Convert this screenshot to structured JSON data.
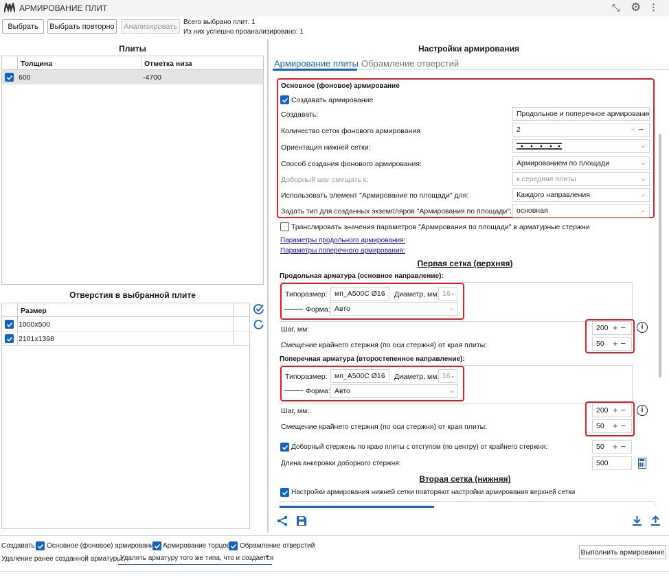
{
  "app": {
    "title": "АРМИРОВАНИЕ ПЛИТ"
  },
  "toolbar": {
    "select_label": "Выбрать",
    "reselect_label": "Выбрать повторно",
    "analyze_label": "Анализировать",
    "total_selected": "Всего выбрано плит: 1",
    "analyzed": "Из них успешно проанализировано: 1"
  },
  "slabs": {
    "title": "Плиты",
    "columns": [
      "Толщина",
      "Отметка низа"
    ],
    "rows": [
      {
        "thickness": "600",
        "bottom": "-4700"
      }
    ]
  },
  "openings": {
    "title": "Отверстия в выбранной плите",
    "column": "Размер",
    "rows": [
      {
        "size": "1000x500"
      },
      {
        "size": "2101x1398"
      }
    ]
  },
  "settings": {
    "title": "Настройки армирования",
    "tabs": [
      {
        "label": "Армирование плиты"
      },
      {
        "label": "Обрамление отверстий"
      }
    ],
    "background": {
      "header": "Основное (фоновое) армирование",
      "create_checkbox": "Создавать армирование",
      "create_label": "Создавать:",
      "create_value": "Продольное и поперечное армирование",
      "mesh_count_label": "Количество сеток фонового армирования",
      "mesh_count_value": "2",
      "orientation_label": "Ориентация нижней сетки:",
      "method_label": "Способ создания фонового армирования:",
      "method_value": "Армированием по площади",
      "offset_label": "Доборный шаг смещать к:",
      "offset_value": "к середине плиты",
      "use_element_label": "Использовать элемент \"Армирование по площади\" для:",
      "use_element_value": "Каждого направления",
      "type_label": "Задать тип для созданных экземпляров \"Армирования по площади\":",
      "type_value": "основная"
    },
    "translate_label": "Транслировать значения параметров \"Армирования по площади\" в арматурные стержни",
    "link_long": "Параметры продольного армирования:",
    "link_cross": "Параметры поперечного армирования:",
    "first_mesh_title": "Первая сетка (верхняя)",
    "long_header": "Продольная арматура (основное направление):",
    "cross_header": "Поперечная арматура (второстепенное направление):",
    "size_label": "Типоразмер:",
    "size_value": "мп_А500С Ø16",
    "diameter_label": "Диаметр, мм:",
    "diameter_value": "16",
    "shape_label": "Форма:",
    "shape_value": "Авто",
    "step_label": "Шаг, мм:",
    "step_value": "200",
    "edge_offset_label": "Смещение крайнего стержня (по оси стержня) от края плиты:",
    "edge_offset_value": "50",
    "extra_bar_label": "Доборный стержень по краю плиты с отступом (по центру) от крайнего стержня:",
    "extra_bar_value": "50",
    "anchor_label": "Длина анкеровки доборного стержня:",
    "anchor_value": "500",
    "second_mesh_title": "Вторая сетка (нижняя)",
    "repeat_label": "Настройки армирования нижней сетки повторяют настройки армирования верхней сетки"
  },
  "footer": {
    "create_label": "Создавать:",
    "opt1": "Основное (фоновое) армирование",
    "opt2": "Армирование торцов",
    "opt3": "Обрамление отверстий",
    "delete_label": "Удаление ранее созданной арматуры:",
    "delete_value": "Удалять арматуру того же типа, что и создается",
    "run_label": "Выполнить армирование"
  },
  "colors": {
    "accent": "#1565c0",
    "highlight": "#e02020",
    "tab_active": "#1565c0"
  }
}
